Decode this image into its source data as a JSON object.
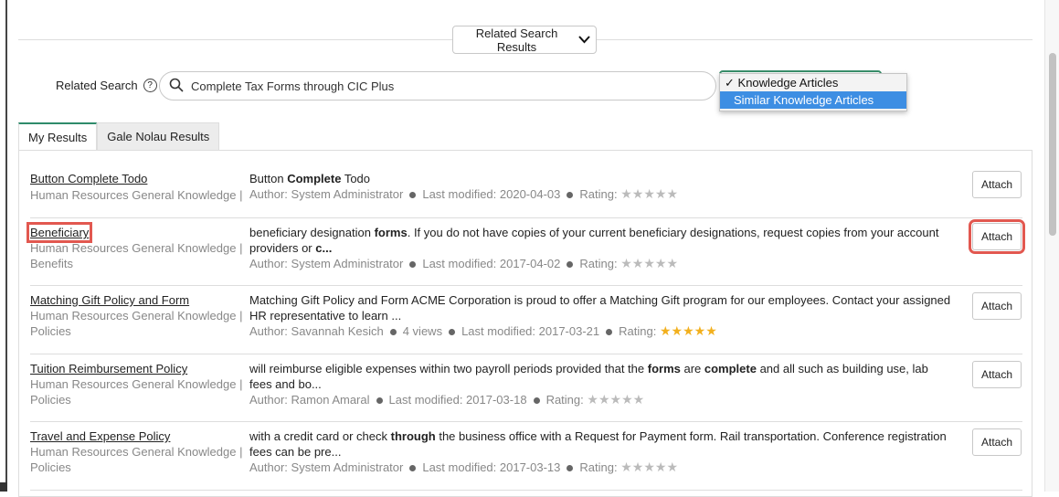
{
  "related_toggle": {
    "label": "Related Search Results"
  },
  "search": {
    "label": "Related Search",
    "value": "Complete Tax Forms through CIC Plus"
  },
  "dropdown": {
    "options": [
      {
        "label": "Knowledge Articles",
        "checked": true
      },
      {
        "label": "Similar Knowledge Articles",
        "highlighted": true
      }
    ],
    "checkmark": "✓"
  },
  "tabs": [
    {
      "label": "My Results",
      "active": true
    },
    {
      "label": "Gale Nolau Results",
      "active": false
    }
  ],
  "results": [
    {
      "title": "Button Complete Todo",
      "meta1": "Human Resources General Knowledge |",
      "meta2": "",
      "desc_plain": "Button ",
      "desc_bold": "Complete",
      "desc_tail": " Todo",
      "author": "Author: System Administrator",
      "views": "",
      "modified": "Last modified: 2020-04-03",
      "rating_label": "Rating:",
      "rating": 0,
      "attach": "Attach"
    },
    {
      "title": "Beneficiary",
      "meta1": "Human Resources General Knowledge |",
      "meta2": "Benefits",
      "desc_plain": "beneficiary designation ",
      "desc_bold": "forms",
      "desc_tail": ". If you do not have copies of your current beneficiary designations, request copies from your account providers or ",
      "desc_bold2": "c...",
      "author": "Author: System Administrator",
      "views": "",
      "modified": "Last modified: 2017-04-02",
      "rating_label": "Rating:",
      "rating": 0,
      "attach": "Attach"
    },
    {
      "title": "Matching Gift Policy and Form",
      "meta1": "Human Resources General Knowledge |",
      "meta2": "Policies",
      "desc_plain": "Matching Gift Policy and Form ACME Corporation is proud to offer a Matching Gift program for our employees. Contact your assigned HR representative to learn ...",
      "author": "Author: Savannah Kesich",
      "views": "4 views",
      "modified": "Last modified: 2017-03-21",
      "rating_label": "Rating:",
      "rating": 5,
      "attach": "Attach"
    },
    {
      "title": "Tuition Reimbursement Policy",
      "meta1": "Human Resources General Knowledge |",
      "meta2": "Policies",
      "desc_plain": "will reimburse eligible expenses within two payroll periods provided that the ",
      "desc_bold": "forms",
      "desc_mid": " are ",
      "desc_bold2": "complete",
      "desc_tail": " and all such as building use, lab fees and bo...",
      "author": "Author: Ramon Amaral",
      "views": "",
      "modified": "Last modified: 2017-03-18",
      "rating_label": "Rating:",
      "rating": 0,
      "attach": "Attach"
    },
    {
      "title": "Travel and Expense Policy",
      "meta1": "Human Resources General Knowledge |",
      "meta2": "Policies",
      "desc_plain": "with a credit card or check ",
      "desc_bold": "through",
      "desc_tail": " the business office with a Request for Payment form. Rail transportation. Conference registration fees can be pre...",
      "author": "Author: System Administrator",
      "views": "",
      "modified": "Last modified: 2017-03-13",
      "rating_label": "Rating:",
      "rating": 0,
      "attach": "Attach"
    }
  ],
  "colors": {
    "accent": "#2e8b6b",
    "highlight": "#e25850",
    "selected": "#3d8ee3",
    "star_gold": "#f2b01e"
  }
}
